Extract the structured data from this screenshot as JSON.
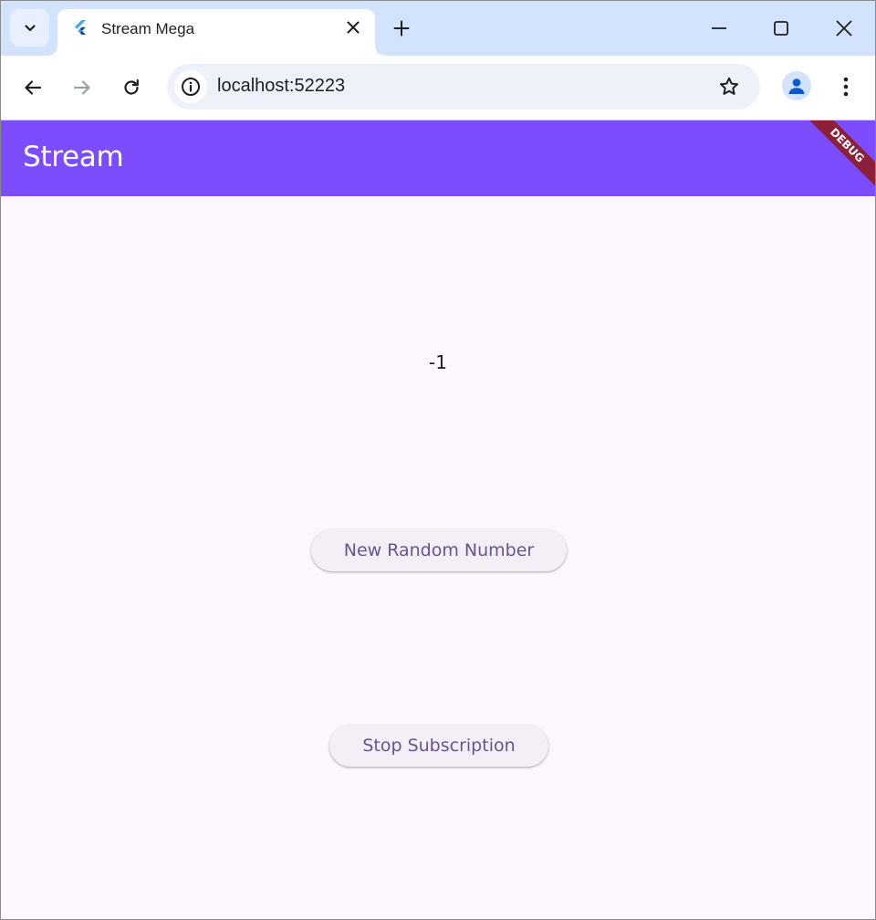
{
  "browser": {
    "tab": {
      "title": "Stream Mega",
      "favicon": "flutter-logo-icon"
    },
    "address_bar": {
      "url": "localhost:52223"
    },
    "icons": {
      "tab_search": "chevron-down-icon",
      "close_tab": "close-icon",
      "new_tab": "plus-icon",
      "minimize": "minimize-icon",
      "maximize": "maximize-icon",
      "close_window": "close-icon",
      "back": "arrow-left-icon",
      "forward": "arrow-right-icon",
      "reload": "reload-icon",
      "site_info": "info-icon",
      "bookmark": "star-icon",
      "profile": "profile-icon",
      "menu": "more-vert-icon"
    },
    "colors": {
      "tabstrip": "#d3e3fd",
      "omnibox": "#edf2fa"
    }
  },
  "app": {
    "appbar": {
      "title": "Stream",
      "debug_banner": "DEBUG"
    },
    "main": {
      "value_text": "-1",
      "buttons": {
        "new_random_number": "New Random Number",
        "stop_subscription": "Stop Subscription"
      }
    },
    "colors": {
      "appbar": "#7c4dff",
      "background": "#fcf6fd",
      "button_text": "#65558f",
      "debug_banner": "#8c1f3a"
    }
  }
}
